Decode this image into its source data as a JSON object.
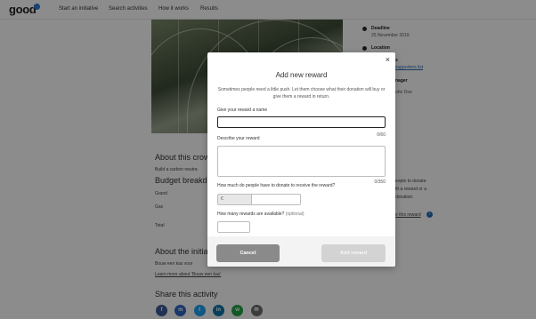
{
  "header": {
    "logo": "good",
    "nav": [
      "Start an initiative",
      "Search activities",
      "How it works",
      "Results"
    ]
  },
  "sidebar_info": {
    "deadline_label": "Deadline",
    "deadline_value": "25 November 2019",
    "location_label": "Location",
    "supporters_label": "s",
    "supporters_value": "supporters list",
    "manager_label": "nager",
    "manager_value": "ohn Doe"
  },
  "main": {
    "about_title": "About this crow",
    "about_text": "Build a carbon neutra",
    "budget_title": "Budget breakd",
    "budget_rows": [
      "Grand",
      "Gas",
      "Total"
    ],
    "initiative_title": "About the initia",
    "initiative_text": "Bouw een kas voor",
    "initiative_link": "Learn more about 'Bouw een kas'",
    "donate_text_1": "eople to donate",
    "donate_text_2": "th a reward or a",
    "donate_text_3": "donation.",
    "reward_link": "e this reward",
    "share_title": "Share this activity",
    "share_buttons": [
      {
        "name": "facebook-icon",
        "glyph": "f",
        "color": "#3b5998"
      },
      {
        "name": "messenger-icon",
        "glyph": "m",
        "color": "#2e66c4"
      },
      {
        "name": "twitter-icon",
        "glyph": "t",
        "color": "#1da1f2"
      },
      {
        "name": "linkedin-icon",
        "glyph": "in",
        "color": "#0e76a8"
      },
      {
        "name": "whatsapp-icon",
        "glyph": "w",
        "color": "#25a244"
      },
      {
        "name": "email-icon",
        "glyph": "✉",
        "color": "#6e6e6e"
      }
    ]
  },
  "modal": {
    "close_glyph": "×",
    "title": "Add new reward",
    "description": "Sometimes people need a little push. Let them choose what their donation will buy or give them a reward in return.",
    "name_label": "Give your reward a name",
    "name_value": "",
    "name_counter": "0/60",
    "desc_label": "Describe your reward",
    "desc_value": "",
    "desc_counter": "0/350",
    "amount_label": "How much do people have to donate to receive the reward?",
    "currency": "€",
    "amount_value": "",
    "qty_label": "How many rewards are available?",
    "qty_optional": "(optional)",
    "qty_value": "",
    "cancel_label": "Cancel",
    "add_label": "Add reward"
  }
}
